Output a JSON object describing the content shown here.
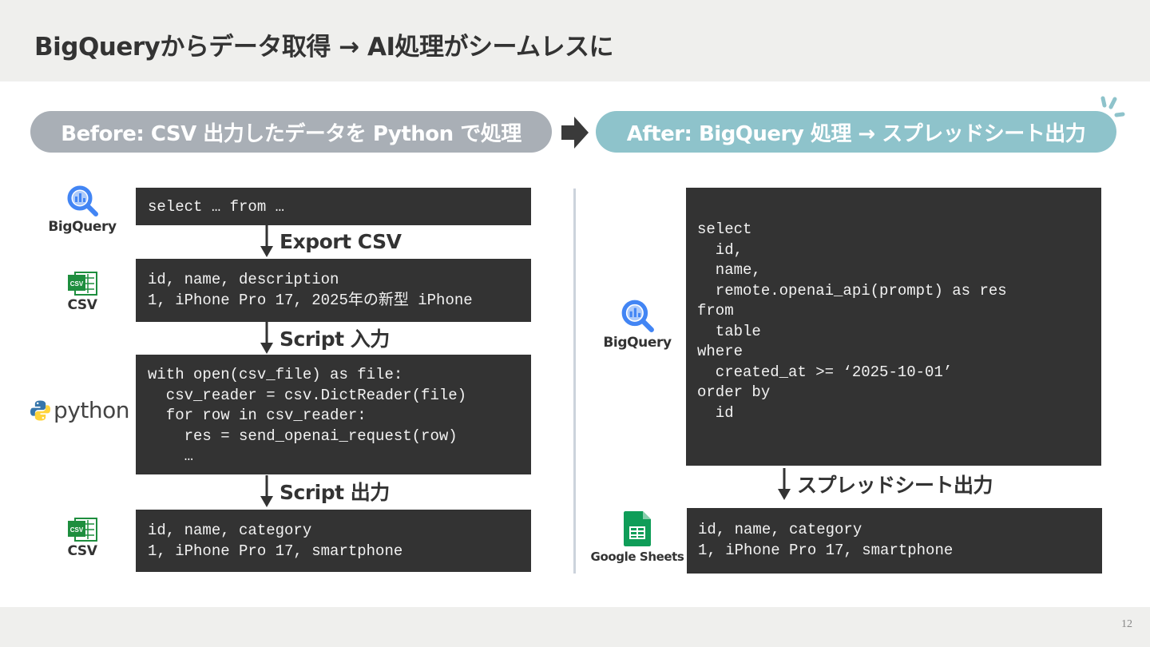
{
  "title": "BigQueryからデータ取得 → AI処理がシームレスに",
  "page_number": "12",
  "before": {
    "pill_label": "Before: CSV 出力したデータを Python で処理",
    "blocks": [
      [
        "select … from …"
      ],
      [
        "id, name, description",
        "1, iPhone Pro 17, 2025年の新型 iPhone"
      ],
      [
        "with open(csv_file) as file:",
        "  csv_reader = csv.DictReader(file)",
        "  for row in csv_reader:",
        "    res = send_openai_request(row)",
        "    …"
      ],
      [
        "id, name, category",
        "1, iPhone Pro 17, smartphone"
      ]
    ],
    "steps": [
      "Export CSV",
      "Script 入力",
      "Script 出力"
    ],
    "logos": {
      "bigquery": "BigQuery",
      "csv_badge": "CSV",
      "csv_label": "CSV",
      "python": "python"
    }
  },
  "after": {
    "pill_label": "After: BigQuery 処理 → スプレッドシート出力",
    "query_lines": [
      "select",
      "  id,",
      "  name,",
      "  remote.openai_api(prompt) as res",
      "from",
      "  table",
      "where",
      "  created_at >= ‘2025-10-01’",
      "order by",
      "  id"
    ],
    "step": "スプレッドシート出力",
    "output_lines": [
      "id, name, category",
      "1, iPhone Pro 17, smartphone"
    ],
    "logos": {
      "bigquery": "BigQuery",
      "sheets": "Google Sheets"
    }
  },
  "colors": {
    "before_pill": "#a9afb6",
    "after_pill": "#8ec3cb",
    "code_bg": "#333333",
    "bigquery_blue": "#4285f4",
    "csv_green": "#1e8e3e",
    "sheets_green": "#0f9d58"
  }
}
